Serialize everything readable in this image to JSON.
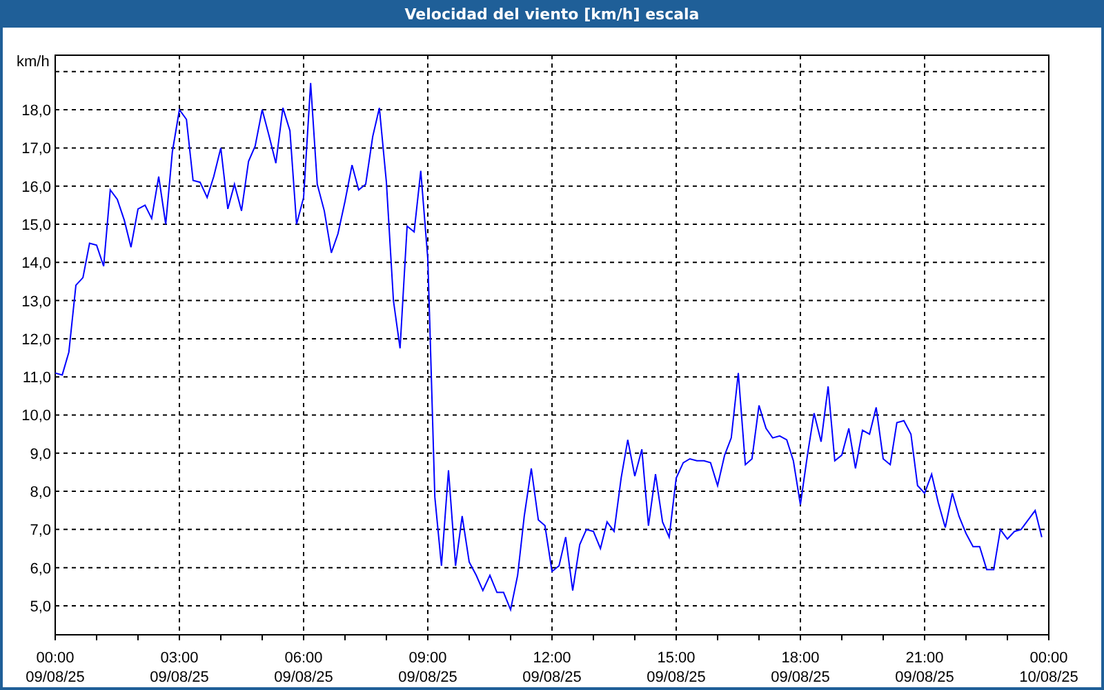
{
  "window": {
    "title": "Velocidad del viento [km/h] escala"
  },
  "chart": {
    "chart_data": {
      "type": "line",
      "ylabel": "km/h",
      "x": [
        0,
        0.17,
        0.33,
        0.5,
        0.67,
        0.83,
        1,
        1.17,
        1.33,
        1.5,
        1.67,
        1.83,
        2,
        2.17,
        2.33,
        2.5,
        2.67,
        2.83,
        3,
        3.17,
        3.33,
        3.5,
        3.67,
        3.83,
        4,
        4.17,
        4.33,
        4.5,
        4.67,
        4.83,
        5,
        5.17,
        5.33,
        5.5,
        5.67,
        5.83,
        6,
        6.17,
        6.33,
        6.5,
        6.67,
        6.83,
        7,
        7.17,
        7.33,
        7.5,
        7.67,
        7.83,
        8,
        8.17,
        8.33,
        8.5,
        8.67,
        8.83,
        9,
        9.06,
        9.17,
        9.33,
        9.5,
        9.67,
        9.83,
        10,
        10.17,
        10.33,
        10.5,
        10.67,
        10.83,
        11,
        11.17,
        11.33,
        11.5,
        11.67,
        11.83,
        12,
        12.17,
        12.33,
        12.5,
        12.67,
        12.83,
        13,
        13.17,
        13.33,
        13.5,
        13.67,
        13.83,
        14,
        14.17,
        14.33,
        14.5,
        14.67,
        14.83,
        15,
        15.17,
        15.33,
        15.5,
        15.67,
        15.83,
        16,
        16.17,
        16.33,
        16.5,
        16.67,
        16.83,
        17,
        17.17,
        17.33,
        17.5,
        17.67,
        17.83,
        18,
        18.17,
        18.33,
        18.5,
        18.67,
        18.83,
        19,
        19.17,
        19.33,
        19.5,
        19.67,
        19.83,
        20,
        20.17,
        20.33,
        20.5,
        20.67,
        20.83,
        21,
        21.17,
        21.33,
        21.5,
        21.67,
        21.83,
        22,
        22.17,
        22.33,
        22.5,
        22.67,
        22.83,
        23,
        23.17,
        23.33,
        23.5,
        23.67,
        23.83
      ],
      "series": [
        {
          "color": "#0000ff",
          "values": [
            11.1,
            11.05,
            11.65,
            13.4,
            13.6,
            14.5,
            14.45,
            13.9,
            15.9,
            15.65,
            15.1,
            14.4,
            15.4,
            15.5,
            15.15,
            16.25,
            15.0,
            16.9,
            18.0,
            17.75,
            16.15,
            16.1,
            15.7,
            16.25,
            17.0,
            15.4,
            16.05,
            15.35,
            16.65,
            17.05,
            18.0,
            17.3,
            16.6,
            18.05,
            17.45,
            15.0,
            15.7,
            18.7,
            16.05,
            15.35,
            14.25,
            14.75,
            15.6,
            16.55,
            15.9,
            16.05,
            17.3,
            18.05,
            16.1,
            13.0,
            11.75,
            14.95,
            14.8,
            16.4,
            14.1,
            11.95,
            7.85,
            6.05,
            8.55,
            6.05,
            7.35,
            6.15,
            5.8,
            5.4,
            5.8,
            5.35,
            5.35,
            4.9,
            5.8,
            7.35,
            8.6,
            7.25,
            7.1,
            5.9,
            6.05,
            6.8,
            5.4,
            6.6,
            7.0,
            6.95,
            6.5,
            7.2,
            6.95,
            8.35,
            9.35,
            8.4,
            9.1,
            7.1,
            8.45,
            7.2,
            6.8,
            8.35,
            8.75,
            8.85,
            8.8,
            8.8,
            8.75,
            8.15,
            8.95,
            9.4,
            11.1,
            8.7,
            8.85,
            10.25,
            9.65,
            9.4,
            9.45,
            9.35,
            8.8,
            7.65,
            8.95,
            10.05,
            9.3,
            10.75,
            8.8,
            8.95,
            9.65,
            8.6,
            9.6,
            9.5,
            10.2,
            8.85,
            8.7,
            9.8,
            9.85,
            9.5,
            8.15,
            7.95,
            8.45,
            7.7,
            7.05,
            7.95,
            7.35,
            6.9,
            6.55,
            6.55,
            5.95,
            5.95,
            7.0,
            6.75,
            6.95,
            7.0,
            7.25,
            7.5,
            6.8
          ]
        }
      ],
      "grid": true,
      "xlim": [
        0,
        24
      ],
      "ylim": [
        4.24,
        19.43
      ],
      "xticks": [
        {
          "value": 0,
          "label": "00:00"
        },
        {
          "value": 3,
          "label": "03:00"
        },
        {
          "value": 6,
          "label": "06:00"
        },
        {
          "value": 9,
          "label": "09:00"
        },
        {
          "value": 12,
          "label": "12:00"
        },
        {
          "value": 15,
          "label": "15:00"
        },
        {
          "value": 18,
          "label": "18:00"
        },
        {
          "value": 21,
          "label": "21:00"
        },
        {
          "value": 24,
          "label": "00:00"
        }
      ],
      "annotations": [
        "09/08/25",
        "09/08/25",
        "09/08/25",
        "09/08/25",
        "09/08/25",
        "09/08/25",
        "09/08/25",
        "09/08/25",
        "10/08/25"
      ],
      "yticks": [
        {
          "value": 5,
          "label": "5,0"
        },
        {
          "value": 6,
          "label": "6,0"
        },
        {
          "value": 7,
          "label": "7,0"
        },
        {
          "value": 8,
          "label": "8,0"
        },
        {
          "value": 9,
          "label": "9,0"
        },
        {
          "value": 10,
          "label": "10,0"
        },
        {
          "value": 11,
          "label": "11,0"
        },
        {
          "value": 12,
          "label": "12,0"
        },
        {
          "value": 13,
          "label": "13,0"
        },
        {
          "value": 14,
          "label": "14,0"
        },
        {
          "value": 15,
          "label": "15,0"
        },
        {
          "value": 16,
          "label": "16,0"
        },
        {
          "value": 17,
          "label": "17,0"
        },
        {
          "value": 18,
          "label": "18,0"
        }
      ]
    }
  }
}
